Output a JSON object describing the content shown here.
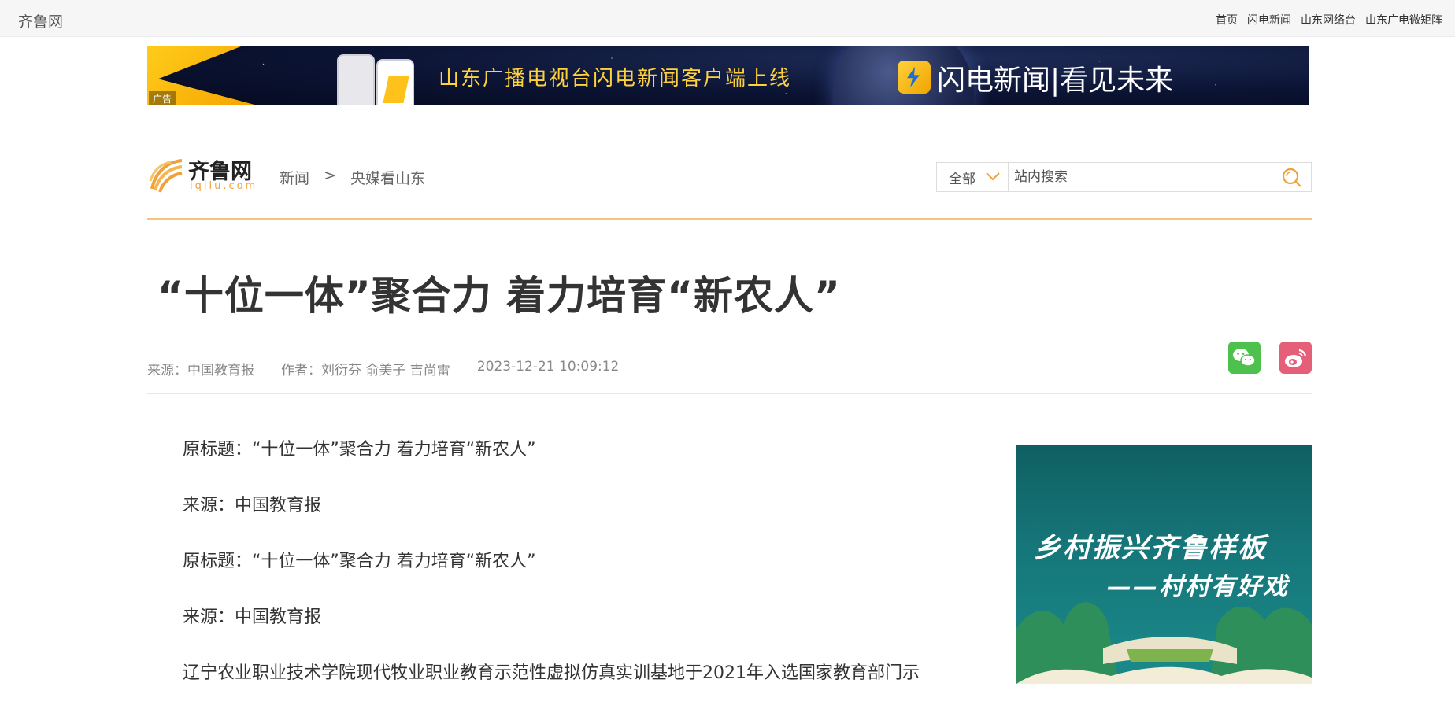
{
  "topbar": {
    "site_name": "齐鲁网",
    "links": [
      "首页",
      "闪电新闻",
      "山东网络台",
      "山东广电微矩阵"
    ]
  },
  "ad_banner": {
    "text": "山东广播电视台闪电新闻客户端上线",
    "brand": "闪电新闻|看见未来",
    "tag": "广告"
  },
  "logo": {
    "name": "齐鲁网",
    "domain": "iqilu.com"
  },
  "breadcrumb": {
    "items": [
      "新闻",
      "央媒看山东"
    ],
    "separator": ">"
  },
  "search": {
    "scope": "全部",
    "placeholder": "站内搜索"
  },
  "article": {
    "title": "“十位一体”聚合力 着力培育“新农人”",
    "source": "来源：中国教育报",
    "author": "作者：刘衍芬 俞美子 吉尚雷",
    "datetime": "2023-12-21 10:09:12",
    "paragraphs": [
      "原标题：“十位一体”聚合力 着力培育“新农人”",
      "来源：中国教育报",
      "原标题：“十位一体”聚合力 着力培育“新农人”",
      "来源：中国教育报",
      "辽宁农业职业技术学院现代牧业职业教育示范性虚拟仿真实训基地于2021年入选国家教育部门示"
    ]
  },
  "side_ad": {
    "headline": "乡村振兴齐鲁样板",
    "subline": "——村村有好戏"
  },
  "colors": {
    "accent": "#f0a23a",
    "rule": "#f6c47a",
    "wechat": "#4ec04e",
    "weibo": "#e55f78"
  }
}
